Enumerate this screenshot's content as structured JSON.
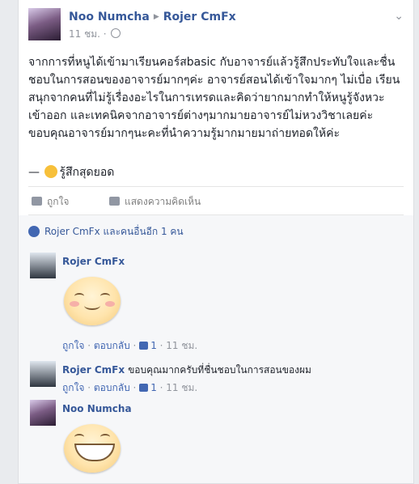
{
  "post": {
    "author": "Noo Numcha",
    "target": "Rojer CmFx",
    "time": "11 ชม.",
    "text": "จากการที่หนูได้เข้ามาเรียนคอร์สbasic กับอาจารย์แล้วรู้สึกประทับใจและชื่นชอบในการสอนของอาจารย์มากๆค่ะ อาจารย์สอนได้เข้าใจมากๆ ไม่เบื่อ เรียนสนุกจากคนที่ไม่รู้เรื่องอะไรในการเทรดและคิดว่ายากมากทำให้หนูรู้จังหวะเข้าออก และเทคนิคจากอาจารย์ต่างๆมากมายอาจารย์ไม่หวงวิชาเลยค่ะขอบคุณอาจารย์มากๆนะคะที่นำความรู้มากมายมาถ่ายทอดให้ค่ะ",
    "feeling_prefix": "—",
    "feeling": "รู้สึกสุดยอด"
  },
  "actions": {
    "like": "ถูกใจ",
    "comment": "แสดงความคิดเห็น"
  },
  "likes_summary": "Rojer CmFx และคนอื่นอีก 1 คน",
  "comments": [
    {
      "author": "Rojer CmFx",
      "text": "",
      "sticker": "smiling-face",
      "like": "ถูกใจ",
      "reply": "ตอบกลับ",
      "likes": "1",
      "time": "11 ชม."
    },
    {
      "author": "Rojer CmFx",
      "text": "ขอบคุณมากครับที่ชื่นชอบในการสอนของผม",
      "like": "ถูกใจ",
      "reply": "ตอบกลับ",
      "likes": "1",
      "time": "11 ชม."
    },
    {
      "author": "Noo Numcha",
      "text": "",
      "sticker": "grinning-face"
    }
  ],
  "colors": {
    "link": "#365899",
    "background": "#e9ebee",
    "muted": "#90949c"
  }
}
